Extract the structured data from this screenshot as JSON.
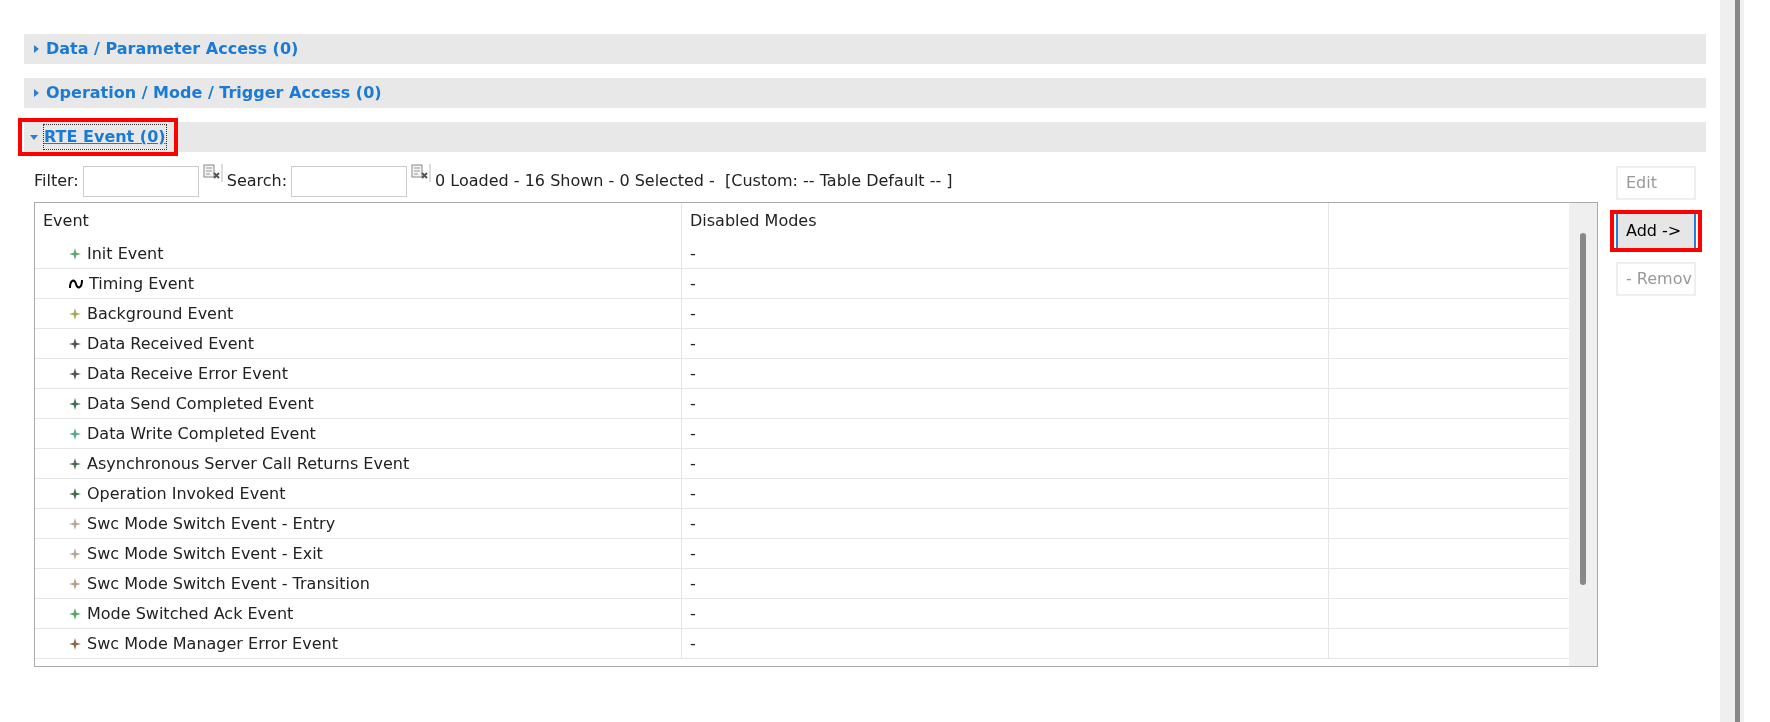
{
  "sections": [
    {
      "title": "Data / Parameter Access (0)",
      "expanded": false,
      "highlighted": false
    },
    {
      "title": "Operation / Mode / Trigger Access (0)",
      "expanded": false,
      "highlighted": false
    },
    {
      "title": "RTE Event (0)",
      "expanded": true,
      "highlighted": true
    }
  ],
  "toolbar": {
    "filter_label": "Filter:",
    "search_label": "Search:",
    "status": "0 Loaded - 16 Shown - 0 Selected -  [Custom: -- Table Default -- ]"
  },
  "table": {
    "columns": [
      "Event",
      "Disabled Modes"
    ],
    "rows": [
      {
        "kind": "star",
        "color": "#5fa86b",
        "event": "Init Event",
        "disabled_modes": "-"
      },
      {
        "kind": "wave",
        "color": "#000000",
        "event": "Timing Event",
        "disabled_modes": "-"
      },
      {
        "kind": "star",
        "color": "#a8a85a",
        "event": "Background Event",
        "disabled_modes": "-"
      },
      {
        "kind": "star",
        "color": "#555555",
        "event": "Data Received Event",
        "disabled_modes": "-"
      },
      {
        "kind": "star",
        "color": "#555555",
        "event": "Data Receive Error Event",
        "disabled_modes": "-"
      },
      {
        "kind": "star",
        "color": "#3f6e55",
        "event": "Data Send Completed Event",
        "disabled_modes": "-"
      },
      {
        "kind": "star",
        "color": "#4fae86",
        "event": "Data Write Completed Event",
        "disabled_modes": "-"
      },
      {
        "kind": "star",
        "color": "#4f6f55",
        "event": "Asynchronous Server Call Returns Event",
        "disabled_modes": "-"
      },
      {
        "kind": "star",
        "color": "#3a6e4a",
        "event": "Operation Invoked Event",
        "disabled_modes": "-"
      },
      {
        "kind": "star",
        "color": "#b8a898",
        "event": "Swc Mode Switch Event - Entry",
        "disabled_modes": "-"
      },
      {
        "kind": "star",
        "color": "#b8a898",
        "event": "Swc Mode Switch Event - Exit",
        "disabled_modes": "-"
      },
      {
        "kind": "star",
        "color": "#b8a088",
        "event": "Swc Mode Switch Event - Transition",
        "disabled_modes": "-"
      },
      {
        "kind": "star",
        "color": "#4fa860",
        "event": "Mode Switched Ack Event",
        "disabled_modes": "-"
      },
      {
        "kind": "star",
        "color": "#8a6a4a",
        "event": "Swc Mode Manager Error Event",
        "disabled_modes": "-"
      }
    ]
  },
  "buttons": [
    {
      "label": "Edit",
      "disabled": true,
      "highlighted": false
    },
    {
      "label": "Add ->",
      "disabled": false,
      "highlighted": true
    },
    {
      "label": "- Remov",
      "disabled": true,
      "highlighted": false
    }
  ]
}
